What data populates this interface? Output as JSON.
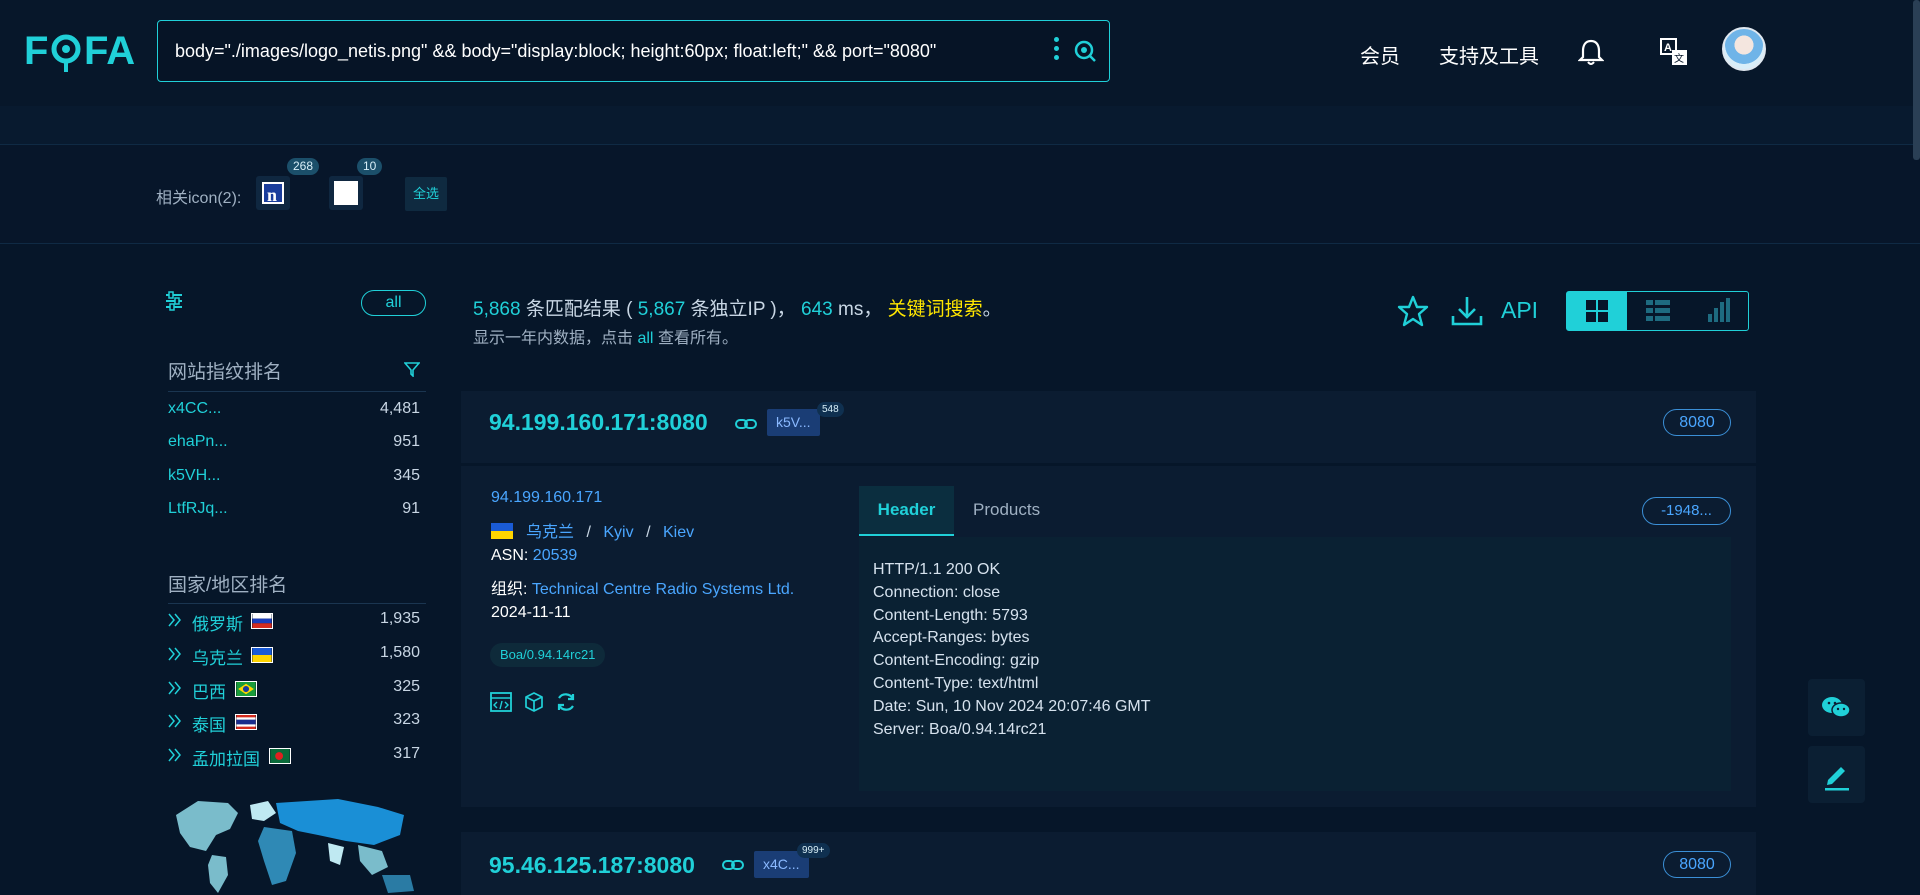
{
  "header": {
    "search_query": "body=\"./images/logo_netis.png\" && body=\"display:block; height:60px; float:left;\" && port=\"8080\"",
    "nav": [
      "会员",
      "支持及工具"
    ]
  },
  "icon_strip": {
    "label": "相关icon(2):",
    "icons": [
      {
        "count": "268"
      },
      {
        "count": "10"
      }
    ],
    "select_all": "全选"
  },
  "sidebar": {
    "all_label": "all",
    "fingerprint_heading": "网站指纹排名",
    "fingerprints": [
      {
        "label": "x4CC...",
        "count": "4,481"
      },
      {
        "label": "ehaPn...",
        "count": "951"
      },
      {
        "label": "k5VH...",
        "count": "345"
      },
      {
        "label": "LtfRJq...",
        "count": "91"
      }
    ],
    "country_heading": "国家/地区排名",
    "countries": [
      {
        "label": "俄罗斯",
        "count": "1,935"
      },
      {
        "label": "乌克兰",
        "count": "1,580"
      },
      {
        "label": "巴西",
        "count": "325"
      },
      {
        "label": "泰国",
        "count": "323"
      },
      {
        "label": "孟加拉国",
        "count": "317"
      }
    ]
  },
  "stats": {
    "match_count": "5,868",
    "match_text": "条匹配结果 (",
    "ip_count": "5,867",
    "ip_text": "条独立IP )，",
    "ms_value": "643",
    "ms_text": "ms，",
    "keyword_link": "关键词搜索",
    "period": "。",
    "sub_prefix": "显示一年内数据，点击",
    "sub_all": "all",
    "sub_suffix": "查看所有。",
    "api_label": "API"
  },
  "results": [
    {
      "ip_port": "94.199.160.171:8080",
      "hash_chip": "k5V...",
      "hash_count": "548",
      "port": "8080",
      "ip": "94.199.160.171",
      "country": "乌克兰",
      "region": "Kyiv",
      "city": "Kiev",
      "asn_label": "ASN:",
      "asn": "20539",
      "org_label": "组织:",
      "org": "Technical Centre Radio Systems Ltd.",
      "date": "2024-11-11",
      "server": "Boa/0.94.14rc21",
      "tabs": [
        "Header",
        "Products"
      ],
      "hash_pill": "-1948...",
      "headers": [
        "HTTP/1.1 200 OK",
        "Connection: close",
        "Content-Length: 5793",
        "Accept-Ranges: bytes",
        "Content-Encoding: gzip",
        "Content-Type: text/html",
        "Date: Sun, 10 Nov 2024 20:07:46 GMT",
        "Server: Boa/0.94.14rc21"
      ]
    },
    {
      "ip_port": "95.46.125.187:8080",
      "hash_chip": "x4C...",
      "hash_count": "999+",
      "port": "8080"
    }
  ],
  "colors": {
    "accent": "#20d0d8",
    "link": "#4aa6ff",
    "keyword": "#ffe600",
    "background": "#061629"
  }
}
